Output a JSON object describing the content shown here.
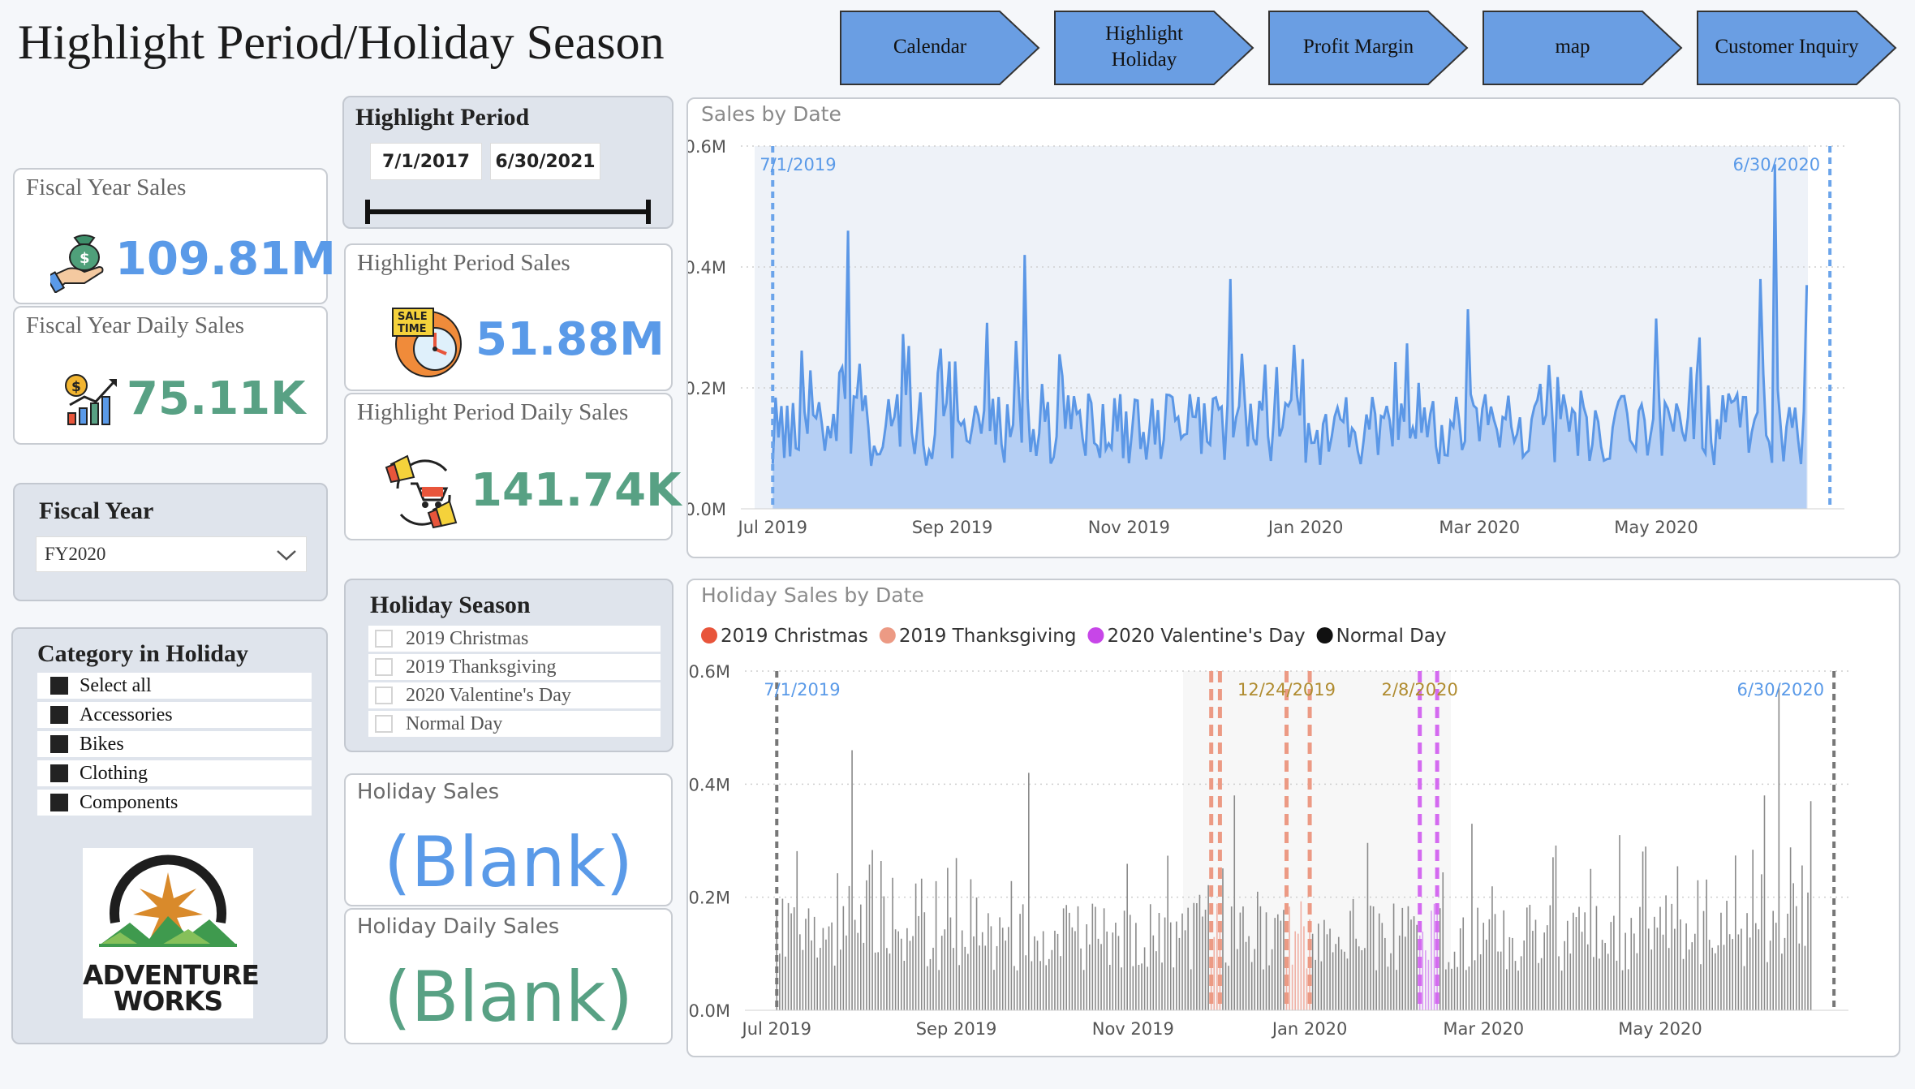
{
  "header": {
    "title": "Highlight Period/Holiday Season"
  },
  "nav": [
    {
      "label": "Calendar"
    },
    {
      "label": "Highlight\nHoliday"
    },
    {
      "label": "Profit Margin"
    },
    {
      "label": "map"
    },
    {
      "label": "Customer Inquiry"
    }
  ],
  "colors": {
    "nav_fill": "#6a9ee3",
    "kpi_blue": "#5a9ae8",
    "kpi_green": "#58a184",
    "series_blue": "#5b97e6",
    "christmas": "#e8553b",
    "thanksgiving": "#ec9a84",
    "valentine": "#c746e8",
    "normal": "#111111"
  },
  "kpis": {
    "fiscal_year_sales": {
      "title": "Fiscal Year Sales",
      "value": "109.81M",
      "icon": "money-hand-icon"
    },
    "fiscal_year_daily_sales": {
      "title": "Fiscal Year Daily Sales",
      "value": "75.11K",
      "icon": "growth-chart-icon"
    },
    "highlight_period_sales": {
      "title": "Highlight Period Sales",
      "value": "51.88M",
      "icon": "sale-time-icon"
    },
    "highlight_period_daily_sales": {
      "title": "Highlight Period Daily Sales",
      "value": "141.74K",
      "icon": "promotion-icon"
    },
    "holiday_sales": {
      "title": "Holiday Sales",
      "value": "(Blank)"
    },
    "holiday_daily_sales": {
      "title": "Holiday Daily Sales",
      "value": "(Blank)"
    }
  },
  "fiscal_year": {
    "title": "Fiscal Year",
    "selected": "FY2020"
  },
  "category": {
    "title": "Category in Holiday",
    "items": [
      "Select all",
      "Accessories",
      "Bikes",
      "Clothing",
      "Components"
    ]
  },
  "highlight_period": {
    "title": "Highlight Period",
    "start": "7/1/2017",
    "end": "6/30/2021"
  },
  "holiday_season": {
    "title": "Holiday Season",
    "items": [
      "2019 Christmas",
      "2019 Thanksgiving",
      "2020 Valentine's Day",
      "Normal Day"
    ]
  },
  "logo": {
    "line1": "ADVENTURE",
    "line2": "WORKS"
  },
  "chart_data": [
    {
      "type": "area",
      "title": "Sales by Date",
      "xlabel": "",
      "ylabel": "",
      "ylim": [
        0,
        0.6
      ],
      "yticks": [
        "0.0M",
        "0.2M",
        "0.4M",
        "0.6M"
      ],
      "xticks": [
        "Jul 2019",
        "Sep 2019",
        "Nov 2019",
        "Jan 2020",
        "Mar 2020",
        "May 2020"
      ],
      "x_range": [
        "2019-06-20",
        "2020-07-05"
      ],
      "reference_lines": [
        {
          "label": "7/1/2019",
          "x": "2019-07-01"
        },
        {
          "label": "6/30/2020",
          "x": "2020-06-30"
        }
      ],
      "legend": "none",
      "grid": true,
      "series": [
        {
          "x_start": "2019-07-01",
          "x_end": "2020-06-22",
          "peaks": [
            {
              "x": "2019-07-27",
              "y": 0.46
            },
            {
              "x": "2019-09-26",
              "y": 0.42
            },
            {
              "x": "2019-12-06",
              "y": 0.38
            },
            {
              "x": "2020-02-26",
              "y": 0.33
            },
            {
              "x": "2020-06-06",
              "y": 0.38
            },
            {
              "x": "2020-06-11",
              "y": 0.57
            },
            {
              "x": "2020-06-22",
              "y": 0.37
            }
          ]
        }
      ]
    },
    {
      "type": "bar",
      "title": "Holiday Sales by Date",
      "xlabel": "",
      "ylabel": "",
      "ylim": [
        0,
        0.6
      ],
      "yticks": [
        "0.0M",
        "0.2M",
        "0.4M",
        "0.6M"
      ],
      "xticks": [
        "Jul 2019",
        "Sep 2019",
        "Nov 2019",
        "Jan 2020",
        "Mar 2020",
        "May 2020"
      ],
      "x_range": [
        "2019-06-20",
        "2020-07-05"
      ],
      "legend": "top-left",
      "grid": true,
      "legend_items": [
        {
          "name": "2019 Christmas",
          "color": "#e8553b"
        },
        {
          "name": "2019 Thanksgiving",
          "color": "#ec9a84"
        },
        {
          "name": "2020 Valentine's Day",
          "color": "#c746e8"
        },
        {
          "name": "Normal Day",
          "color": "#111111"
        }
      ],
      "reference_lines": [
        {
          "label": "7/1/2019",
          "x": "2019-07-01"
        },
        {
          "label": "12/24/2019",
          "x": "2019-12-24"
        },
        {
          "label": "2/8/2020",
          "x": "2020-02-08"
        },
        {
          "label": "6/30/2020",
          "x": "2020-06-30"
        }
      ],
      "holiday_bands": [
        {
          "name": "2019 Thanksgiving",
          "start": "2019-11-28",
          "end": "2019-12-01"
        },
        {
          "name": "2019 Christmas",
          "start": "2019-12-24",
          "end": "2020-01-01"
        },
        {
          "name": "2020 Valentine's Day",
          "start": "2020-02-08",
          "end": "2020-02-14"
        }
      ]
    }
  ]
}
